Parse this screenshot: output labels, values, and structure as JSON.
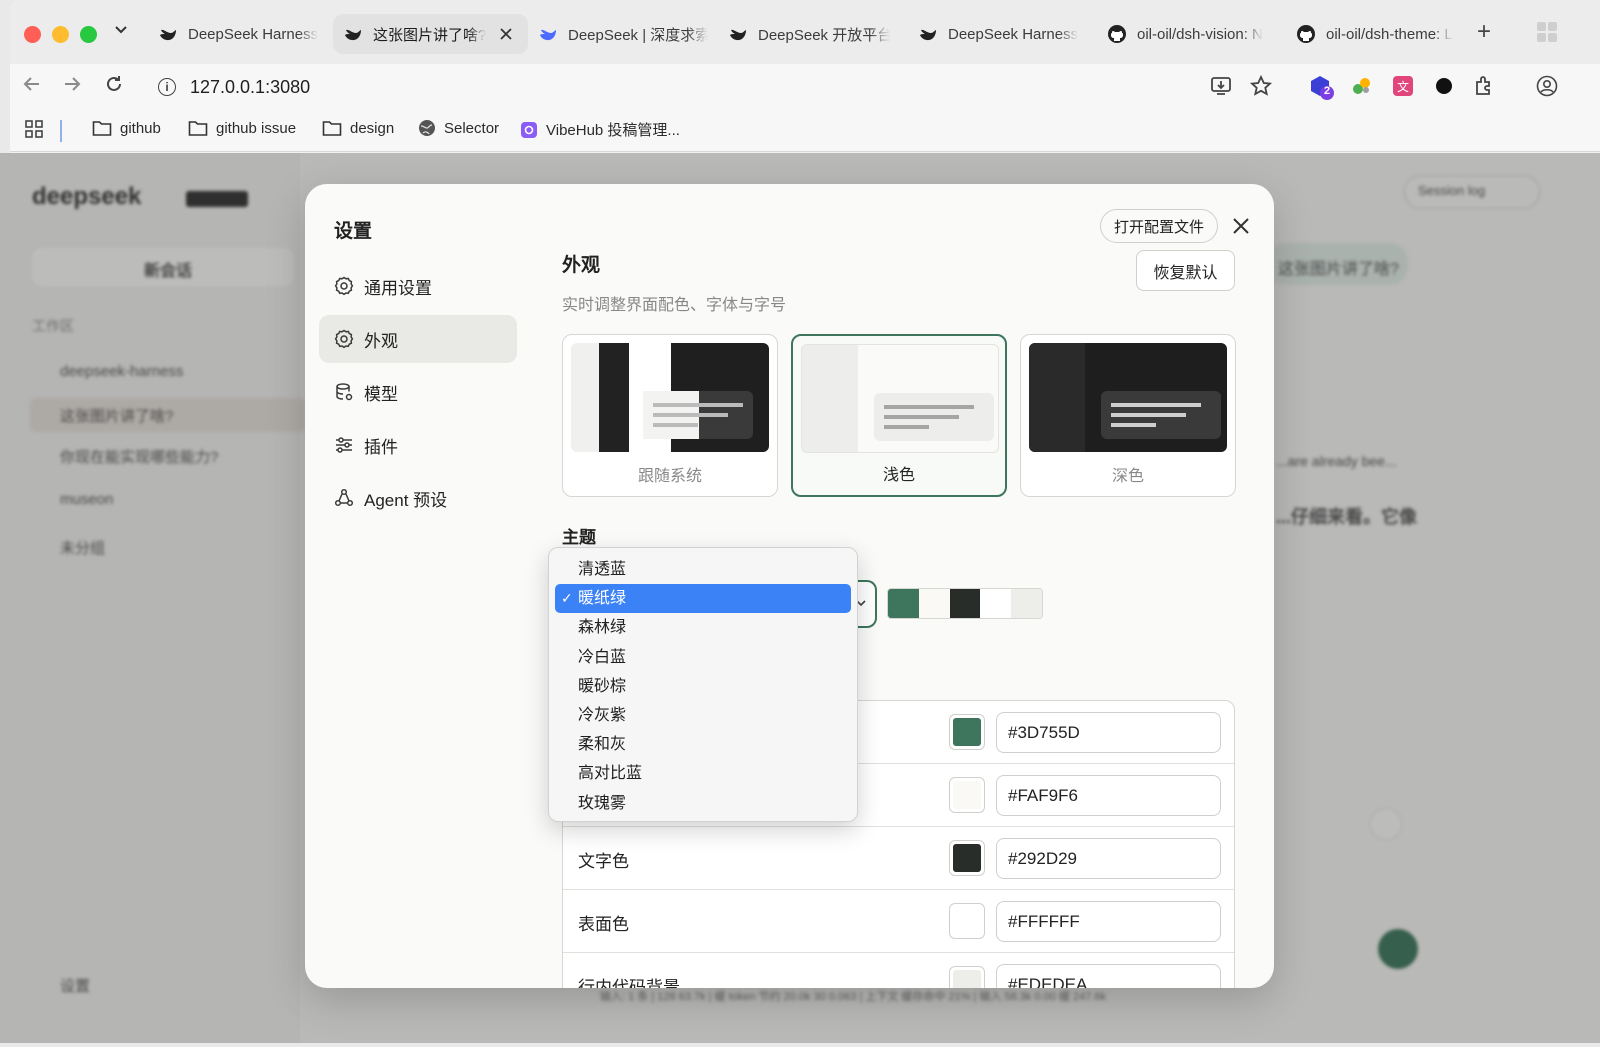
{
  "browser": {
    "tabs": [
      {
        "title": "DeepSeek Harness",
        "active": false,
        "icon": "deepseek-whale-icon"
      },
      {
        "title": "这张图片讲了啥?",
        "active": true,
        "icon": "deepseek-whale-icon"
      },
      {
        "title": "DeepSeek | 深度求索",
        "active": false,
        "icon": "deepseek-blue-whale-icon"
      },
      {
        "title": "DeepSeek 开放平台",
        "active": false,
        "icon": "deepseek-whale-icon"
      },
      {
        "title": "DeepSeek Harness",
        "active": false,
        "icon": "deepseek-whale-icon"
      },
      {
        "title": "oil-oil/dsh-vision: N",
        "active": false,
        "icon": "github-icon"
      },
      {
        "title": "oil-oil/dsh-theme: L",
        "active": false,
        "icon": "github-icon"
      }
    ],
    "new_tab": "+",
    "url": "127.0.0.1:3080",
    "extension_badge": "2",
    "bookmarks": [
      {
        "label": "github",
        "icon": "folder-icon"
      },
      {
        "label": "github issue",
        "icon": "folder-icon"
      },
      {
        "label": "design",
        "icon": "folder-icon"
      },
      {
        "label": "Selector",
        "icon": "globe-icon"
      },
      {
        "label": "VibeHub 投稿管理...",
        "icon": "vibehub-icon"
      }
    ]
  },
  "background_app": {
    "logo": "deepseek",
    "logo_badge": "HARNESS",
    "new_chat": "新会话",
    "workspace": "工作区",
    "projects": [
      "deepseek-harness",
      "museon",
      "未分组"
    ],
    "chats": [
      "这张图片讲了啥?",
      "你现在能实现哪些能力?"
    ],
    "settings": "设置",
    "session_log": "Session log",
    "header_title": "这张图片讲了啥?",
    "user_msg": "这张图片讲了啥?",
    "reply_en": "...are already bee...",
    "reply_cn": "...仔细来看。它像",
    "status_bar": "输入: 1 条 | 128 63.7k | 缓 token 节约 20.0k 30 0.063 | 上下文 缓存命中 21% | 输入 58.3k 0.00 缓 247.6k"
  },
  "settings": {
    "title": "设置",
    "open_config": "打开配置文件",
    "nav": [
      {
        "label": "通用设置",
        "icon": "gear-icon",
        "active": false
      },
      {
        "label": "外观",
        "icon": "gear-icon",
        "active": true
      },
      {
        "label": "模型",
        "icon": "database-icon",
        "active": false
      },
      {
        "label": "插件",
        "icon": "sliders-icon",
        "active": false
      },
      {
        "label": "Agent 预设",
        "icon": "agent-icon",
        "active": false
      }
    ],
    "appearance": {
      "title": "外观",
      "subtitle": "实时调整界面配色、字体与字号",
      "reset": "恢复默认",
      "modes": [
        {
          "label": "跟随系统",
          "selected": false
        },
        {
          "label": "浅色",
          "selected": true
        },
        {
          "label": "深色",
          "selected": false
        }
      ],
      "theme_label": "主题",
      "theme_swatches": [
        "#3D755D",
        "#FAF9F6",
        "#292D29",
        "#FFFFFF",
        "#EDEDEA"
      ],
      "colors": [
        {
          "label": "",
          "hex": "#3D755D",
          "swatch": "#3D755D"
        },
        {
          "label": "",
          "hex": "#FAF9F6",
          "swatch": "#FAF9F6"
        },
        {
          "label": "文字色",
          "hex": "#292D29",
          "swatch": "#292D29"
        },
        {
          "label": "表面色",
          "hex": "#FFFFFF",
          "swatch": "#FFFFFF"
        },
        {
          "label": "行内代码背景",
          "hex": "#EDEDEA",
          "swatch": "#EDEDEA"
        }
      ]
    },
    "theme_dropdown": {
      "selected": "暖纸绿",
      "options": [
        "清透蓝",
        "暖纸绿",
        "森林绿",
        "冷白蓝",
        "暖砂棕",
        "冷灰紫",
        "柔和灰",
        "高对比蓝",
        "玫瑰雾"
      ]
    }
  },
  "colors": {
    "accent": "#3D755D",
    "selection": "#3B82F6"
  }
}
